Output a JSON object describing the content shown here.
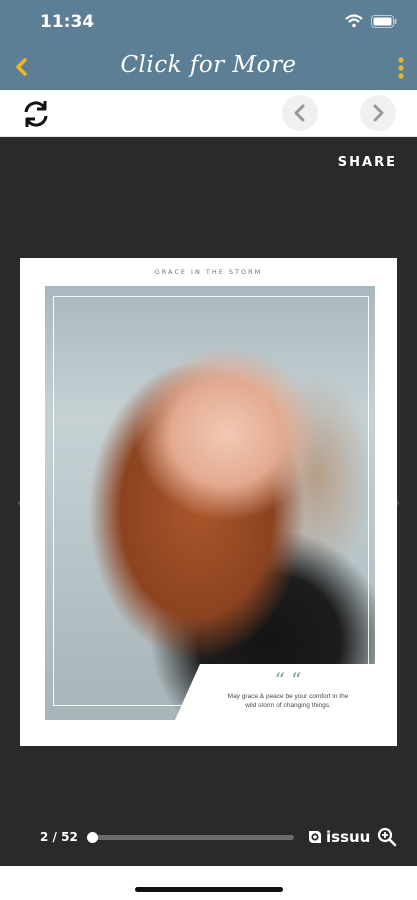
{
  "status_bar": {
    "time": "11:34"
  },
  "header": {
    "title": "Click for More"
  },
  "viewer": {
    "share_label": "SHARE",
    "page_header": "GRACE IN THE STORM",
    "quote_marks": "“ “",
    "quote_line1": "May grace & peace be your comfort in the",
    "quote_line2": "wild storm of changing things.",
    "page_indicator": "2 / 52",
    "progress_fraction": 0.02,
    "brand": "issuu"
  },
  "colors": {
    "header_bg": "#5d7f95",
    "accent": "#f0b429",
    "viewer_bg": "#2a2a2a"
  },
  "icons": [
    "back-icon",
    "more-icon",
    "refresh-icon",
    "prev-page-icon",
    "next-page-icon",
    "zoom-icon",
    "issuu-logo-icon"
  ]
}
